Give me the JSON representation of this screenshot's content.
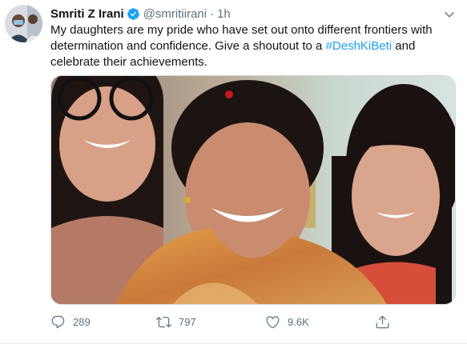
{
  "tweet": {
    "author_name": "Smriti Z Irani",
    "handle": "@smritiirani",
    "separator": "·",
    "time": "1h",
    "text_line1": "My daughters are my pride who have set out onto different frontiers with",
    "text_line2": "determination and confidence. Give a shoutout to a ",
    "hashtag": "#DeshKiBeti",
    "text_line2_end": " and",
    "text_line3": "celebrate their achievements.",
    "stats": {
      "replies": "289",
      "retweets": "797",
      "likes": "9.6K"
    }
  },
  "colors": {
    "link": "#1da1f2",
    "secondary_text": "#5b7083",
    "verified": "#1da1f2"
  },
  "icons": {
    "verified": "verified-badge-icon",
    "more": "chevron-down-icon",
    "reply": "reply-icon",
    "retweet": "retweet-icon",
    "like": "heart-icon",
    "share": "share-icon"
  }
}
